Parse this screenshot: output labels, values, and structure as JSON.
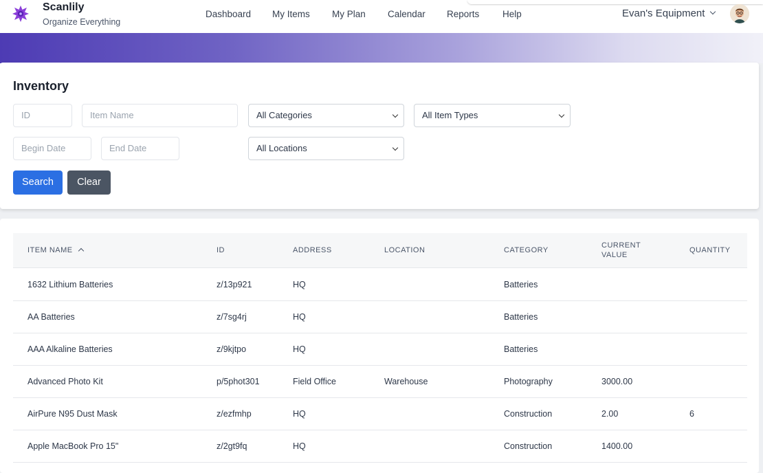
{
  "brand": {
    "name": "Scanlily",
    "tagline": "Organize Everything",
    "accent": "#7c3aed"
  },
  "nav": [
    "Dashboard",
    "My Items",
    "My Plan",
    "Calendar",
    "Reports",
    "Help"
  ],
  "account": {
    "label": "Evan's Equipment"
  },
  "filters": {
    "title": "Inventory",
    "id_placeholder": "ID",
    "name_placeholder": "Item Name",
    "category_value": "All Categories",
    "type_value": "All Item Types",
    "begin_placeholder": "Begin Date",
    "end_placeholder": "End Date",
    "location_value": "All Locations",
    "search_label": "Search",
    "clear_label": "Clear"
  },
  "table": {
    "headers": {
      "name": "ITEM NAME",
      "id": "ID",
      "address": "ADDRESS",
      "location": "LOCATION",
      "category": "CATEGORY",
      "value_line1": "CURRENT",
      "value_line2": "VALUE",
      "quantity": "QUANTITY"
    },
    "rows": [
      {
        "name": "1632 Lithium Batteries",
        "id": "z/13p921",
        "address": "HQ",
        "location": "",
        "category": "Batteries",
        "value": "",
        "quantity": ""
      },
      {
        "name": "AA Batteries",
        "id": "z/7sg4rj",
        "address": "HQ",
        "location": "",
        "category": "Batteries",
        "value": "",
        "quantity": ""
      },
      {
        "name": "AAA Alkaline Batteries",
        "id": "z/9kjtpo",
        "address": "HQ",
        "location": "",
        "category": "Batteries",
        "value": "",
        "quantity": ""
      },
      {
        "name": "Advanced Photo Kit",
        "id": "p/5phot301",
        "address": "Field Office",
        "location": "Warehouse",
        "category": "Photography",
        "value": "3000.00",
        "quantity": ""
      },
      {
        "name": "AirPure N95 Dust Mask",
        "id": "z/ezfmhp",
        "address": "HQ",
        "location": "",
        "category": "Construction",
        "value": "2.00",
        "quantity": "6"
      },
      {
        "name": "Apple MacBook Pro 15\"",
        "id": "z/2gt9fq",
        "address": "HQ",
        "location": "",
        "category": "Construction",
        "value": "1400.00",
        "quantity": ""
      }
    ]
  }
}
